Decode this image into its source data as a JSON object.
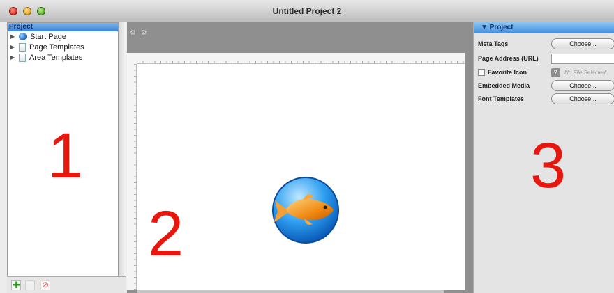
{
  "window": {
    "title": "Untitled Project 2"
  },
  "left_panel": {
    "header": "Project",
    "items": [
      {
        "label": "Start Page",
        "icon": "globe-icon"
      },
      {
        "label": "Page Templates",
        "icon": "document-icon"
      },
      {
        "label": "Area Templates",
        "icon": "document-icon"
      }
    ],
    "annotation": "1"
  },
  "center": {
    "annotation": "2",
    "controls": "⚙ ⚙"
  },
  "inspector": {
    "header": "▼ Project",
    "rows": [
      {
        "label": "Meta Tags",
        "button": "Choose..."
      },
      {
        "label": "Page Address (URL)",
        "value": ""
      },
      {
        "label": "Favorite Icon",
        "help": "?",
        "status": "No File Selected"
      },
      {
        "label": "Embedded Media",
        "button": "Choose..."
      },
      {
        "label": "Font Templates",
        "button": "Choose..."
      }
    ],
    "annotation": "3"
  },
  "colors": {
    "annotation_red": "#e8160c",
    "selection_blue": "#3a83d6",
    "canvas_gray": "#8f8f8f"
  }
}
